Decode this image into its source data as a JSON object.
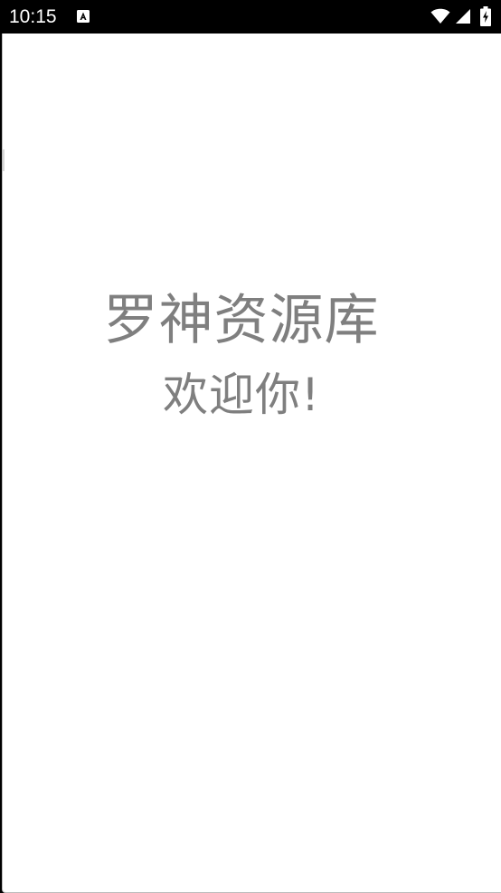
{
  "status_bar": {
    "time": "10:15",
    "icons": [
      "notification-a-icon",
      "wifi-icon",
      "cell-signal-icon",
      "battery-charging-icon"
    ]
  },
  "splash": {
    "title": "罗神资源库",
    "subtitle": "欢迎你!",
    "text_color": "#7f7f7f",
    "background": "#ffffff"
  }
}
